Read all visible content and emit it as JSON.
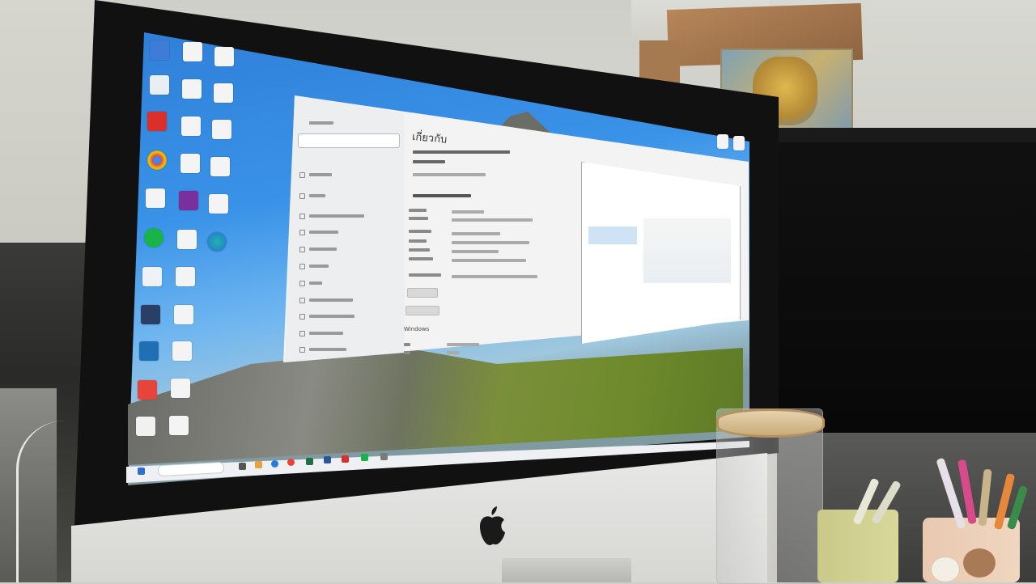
{
  "scene": {
    "description_type": "photo-of-screen"
  },
  "settings_window": {
    "page_title": "เกี่ยวกับ",
    "sidebar_search_placeholder": "",
    "sections": {
      "windows_spec": "Windows"
    }
  },
  "colors": {
    "desktop_blue": "#2f7fd8",
    "window_bg": "#f3f3f3",
    "taskbar_bg": "#eef0f3"
  }
}
